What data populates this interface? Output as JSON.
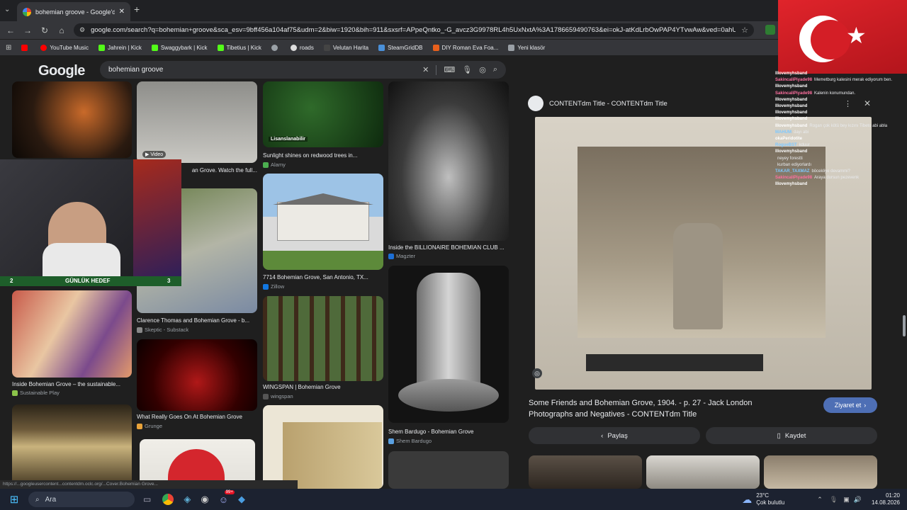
{
  "browser": {
    "tab_title": "bohemian groove - Google'da Ara",
    "new_tab": "+",
    "url": "google.com/search?q=bohemian+groove&sca_esv=9bff456a104af75&udm=2&biw=1920&bih=911&sxsrf=APpeQntko_-G_avcz3G9978RL4h5UxNxtA%3A1786659490763&ei=okJ-atKdLrbOwPAP4YTvwAw&ved=0ahUK...",
    "bookmarks": [
      {
        "label": "",
        "color": "#ff0000"
      },
      {
        "label": "YouTube Music",
        "color": "#ff0000"
      },
      {
        "label": "Jahrein | Kick",
        "color": "#53fc18"
      },
      {
        "label": "Swaggybark | Kick",
        "color": "#53fc18"
      },
      {
        "label": "Tibetius | Kick",
        "color": "#53fc18"
      },
      {
        "label": "",
        "color": "#9aa0a6"
      },
      {
        "label": "roads",
        "color": "#dddddd"
      },
      {
        "label": "Velutan Harita",
        "color": "#444444"
      },
      {
        "label": "SteamGridDB",
        "color": "#4a90d9"
      },
      {
        "label": "DIY Roman Eva Foa...",
        "color": "#e8601c"
      },
      {
        "label": "Yeni klasör",
        "color": "#9aa0a6"
      }
    ]
  },
  "search": {
    "logo": "Google",
    "query": "bohemian groove"
  },
  "results": [
    {
      "caption": "",
      "source": ""
    },
    {
      "caption": "an Grove. Watch the full...",
      "source": "",
      "badge": "▶ Video"
    },
    {
      "caption": "Sunlight shines on redwood trees in...",
      "source": "Alamy",
      "badge": "Lisanslanabilir"
    },
    {
      "caption": "Inside the BILLIONAIRE BOHEMIAN CLUB ...",
      "source": "Magzter"
    },
    {
      "caption": "7714 Bohemian Grove, San Antonio, TX...",
      "source": "Zillow"
    },
    {
      "caption": "Clarence Thomas and Bohemian Grove - b...",
      "source": "Skeptic - Substack"
    },
    {
      "caption": "Inside Bohemian Grove – the sustainable...",
      "source": "Sustainable Play"
    },
    {
      "caption": "WINGSPAN | Bohemian Grove",
      "source": "wingspan"
    },
    {
      "caption": "Shem Bardugo - Bohemian Grove",
      "source": "Shem Bardugo"
    },
    {
      "caption": "What Really Goes On At Bohemian Grove",
      "source": "Grunge"
    }
  ],
  "status_url": "https://...googleusercontent...contentdm.oclc.org/...Cover.Bohemian Grove...",
  "panel": {
    "site_title": "CONTENTdm Title - CONTENTdm Title",
    "caption": "Some Friends and Bohemian Grove, 1904. - p. 27 - Jack London Photographs and Negatives - CONTENTdm Title",
    "visit_label": "Ziyaret et",
    "share_label": "Paylaş",
    "save_label": "Kaydet"
  },
  "stream": {
    "goal_left": "2",
    "goal_label": "GÜNLÜK HEDEF",
    "goal_right": "3"
  },
  "chat": [
    {
      "name": "lllovemyhsband",
      "text": "",
      "color": "#ffffff"
    },
    {
      "name": "SakincaliPiyade98",
      "text": "Memetburg kalesini merak ediyorum ben.",
      "color": "#ff6fa0"
    },
    {
      "name": "lllovemyhsband",
      "text": "",
      "color": "#ffffff"
    },
    {
      "name": "SakincaliPiyade98",
      "text": "Kalenin konumundan.",
      "color": "#ff6fa0"
    },
    {
      "name": "lllovemyhsband",
      "text": "",
      "color": "#ffffff"
    },
    {
      "name": "lllovemyhsband",
      "text": "",
      "color": "#ffffff"
    },
    {
      "name": "lllovemyhsband",
      "text": "",
      "color": "#ffffff"
    },
    {
      "name": "lllovemyhsband",
      "text": "",
      "color": "#ffffff"
    },
    {
      "name": "lllovemyhsband",
      "text": "Rogan çok kötü bey kızını Tibeto abi abla",
      "color": "#ffffff"
    },
    {
      "name": "MAHUM",
      "text": "dayı abi",
      "color": "#7ec8ff"
    },
    {
      "name": "okaPeridotite",
      "text": "",
      "color": "#ffffff"
    },
    {
      "name": "RogueBST",
      "text": "kduur",
      "color": "#7ec8ff"
    },
    {
      "name": "lllovemyhsband",
      "text": "",
      "color": "#ffffff"
    },
    {
      "name": "",
      "text": "neyey forestti",
      "color": "#ffffff"
    },
    {
      "name": "",
      "text": "kurban ediyorlardı",
      "color": "#ffffff"
    },
    {
      "name": "TAKAR_TAXMAZ",
      "text": "böcekliye devammi?",
      "color": "#7ec8ff"
    },
    {
      "name": "SakincaliPiyade98",
      "text": "Araya dursun pezevenk",
      "color": "#ff6fa0"
    },
    {
      "name": "lllovemyhsband",
      "text": "",
      "color": "#ffffff"
    }
  ],
  "taskbar": {
    "search_placeholder": "Ara",
    "temperature": "23°C",
    "weather": "Çok bulutlu",
    "time": "01:20",
    "date": "14.08.2026",
    "badge_count": "99+"
  }
}
